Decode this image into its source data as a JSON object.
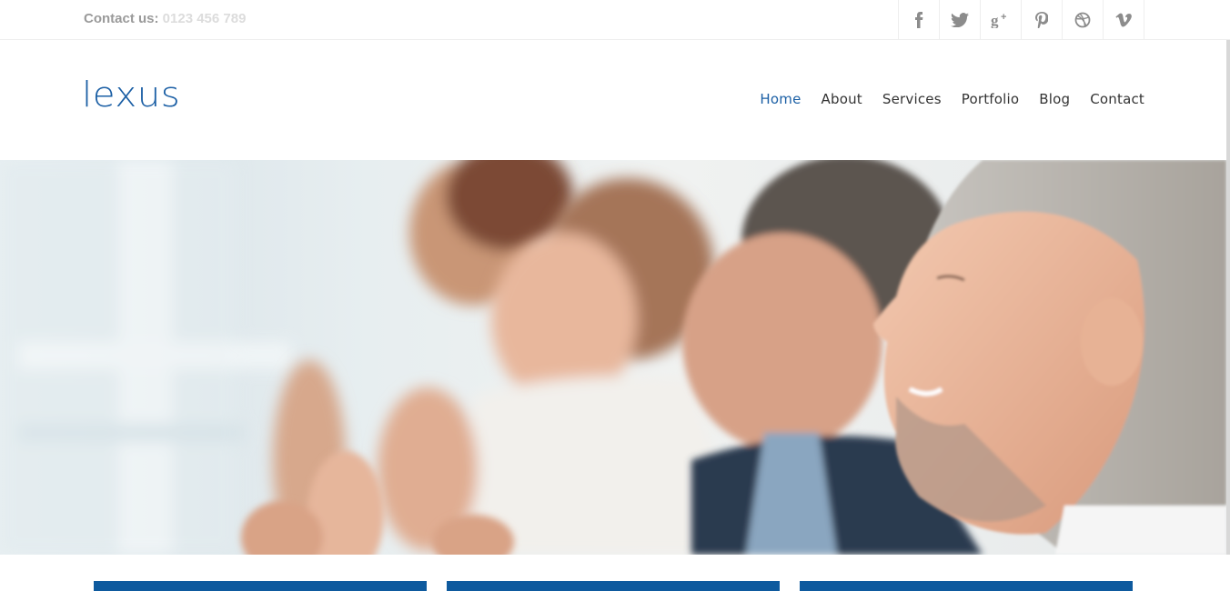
{
  "topbar": {
    "contact_label": "Contact us:",
    "phone": "0123 456 789",
    "social": [
      {
        "name": "facebook-icon",
        "glyph": "f"
      },
      {
        "name": "twitter-icon",
        "glyph": "t"
      },
      {
        "name": "google-plus-icon",
        "glyph": "g+"
      },
      {
        "name": "pinterest-icon",
        "glyph": "p"
      },
      {
        "name": "dribbble-icon",
        "glyph": "◎"
      },
      {
        "name": "vimeo-icon",
        "glyph": "v"
      }
    ]
  },
  "header": {
    "logo": "lexus",
    "nav": [
      "Home",
      "About",
      "Services",
      "Portfolio",
      "Blog",
      "Contact"
    ],
    "active": "Home"
  },
  "hero": {
    "image": "people-applauding-photo"
  },
  "colors": {
    "brand": "#1b5fa5",
    "feature_box": "#0e5a9e",
    "muted": "#9a9a9a"
  }
}
